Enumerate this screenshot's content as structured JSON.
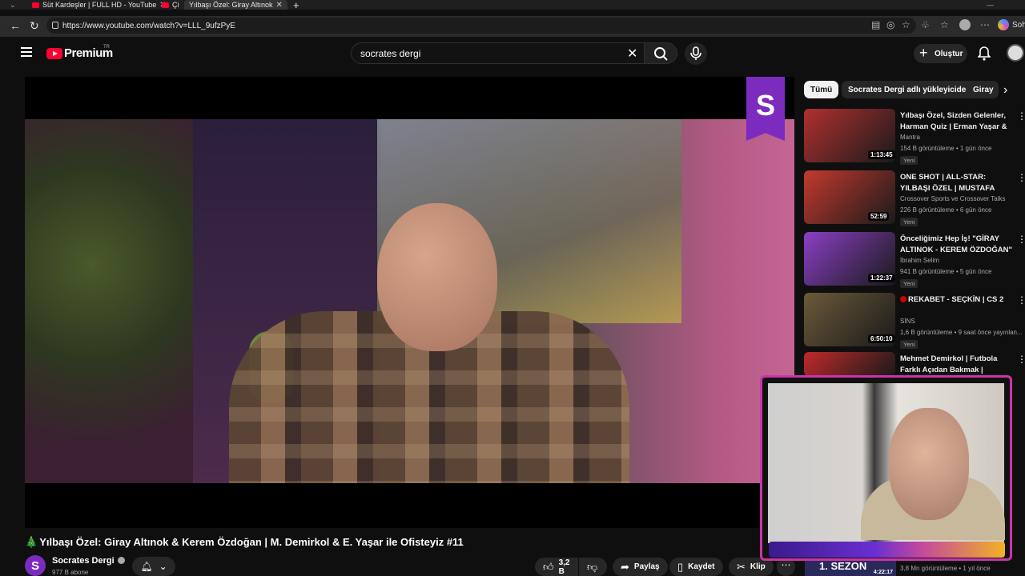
{
  "browser": {
    "tabs": [
      {
        "label": "Süt Kardeşler | FULL HD - YouTube"
      },
      {
        "label": "Çi"
      },
      {
        "label": "Yılbaşı Özel: Giray Altınok"
      }
    ],
    "url": "https://www.youtube.com/watch?v=LLL_9ufzPyE",
    "profile_label": "Soh"
  },
  "header": {
    "logo_text": "Premium",
    "logo_sup": "TR",
    "search_value": "socrates dergi",
    "create_label": "Oluştur"
  },
  "video": {
    "title": "Yılbaşı Özel: Giray Altınok & Kerem Özdoğan | M. Demirkol & E. Yaşar ile Ofisteyiz #11",
    "title_emoji": "🎄",
    "channel_badge": "S",
    "channel_name": "Socrates Dergi",
    "subscribers": "977 B abone",
    "likes": "3,2 B",
    "share_label": "Paylaş",
    "save_label": "Kaydet",
    "clip_label": "Klip"
  },
  "chips": [
    {
      "label": "Tümü"
    },
    {
      "label": "Socrates Dergi adlı yükleyiciden"
    },
    {
      "label": "Giray"
    }
  ],
  "recommendations": [
    {
      "title": "Yılbaşı Özel, Sizden Gelenler, Harman Quiz | Erman Yaşar & ...",
      "channel": "Mantra",
      "meta": "154 B görüntüleme • 1 gün önce",
      "badge": "Yeni",
      "duration": "1:13:45",
      "thumb_color": "#b03030"
    },
    {
      "title": "ONE SHOT | ALL-STAR: YILBAŞI ÖZEL | MUSTAFA DEMİRTAŞ, ...",
      "channel": "Crossover Sports ve Crossover Talks",
      "meta": "226 B görüntüleme • 6 gün önce",
      "badge": "Yeni",
      "duration": "52:59",
      "thumb_color": "#c23a2e"
    },
    {
      "title": "Önceliğimiz Hep İş! \"GİRAY ALTINOK - KEREM ÖZDOĞAN\" ...",
      "channel": "İbrahim Selim",
      "meta": "941 B görüntüleme • 5 gün önce",
      "badge": "Yeni",
      "duration": "1:22:37",
      "thumb_color": "#8a3fc4"
    },
    {
      "title": "REKABET - SEÇKİN | CS 2",
      "channel": "SİNS",
      "meta": "1,6 B görüntüleme • 9 saat önce yayınlan...",
      "badge": "Yeni",
      "duration": "6:50:10",
      "thumb_color": "#6b5a3a",
      "live_dot": true
    },
    {
      "title": "Mehmet Demirkol | Futbola Farklı Açıdan Bakmak | Kimsin...",
      "channel": "",
      "meta": "",
      "badge": "",
      "duration": "",
      "thumb_color": "#c02a2a"
    }
  ],
  "partial_rec": {
    "title": "1. SEZON",
    "duration": "4:22:17",
    "meta": "3,8 Mn görüntüleme • 1 yıl önce"
  }
}
